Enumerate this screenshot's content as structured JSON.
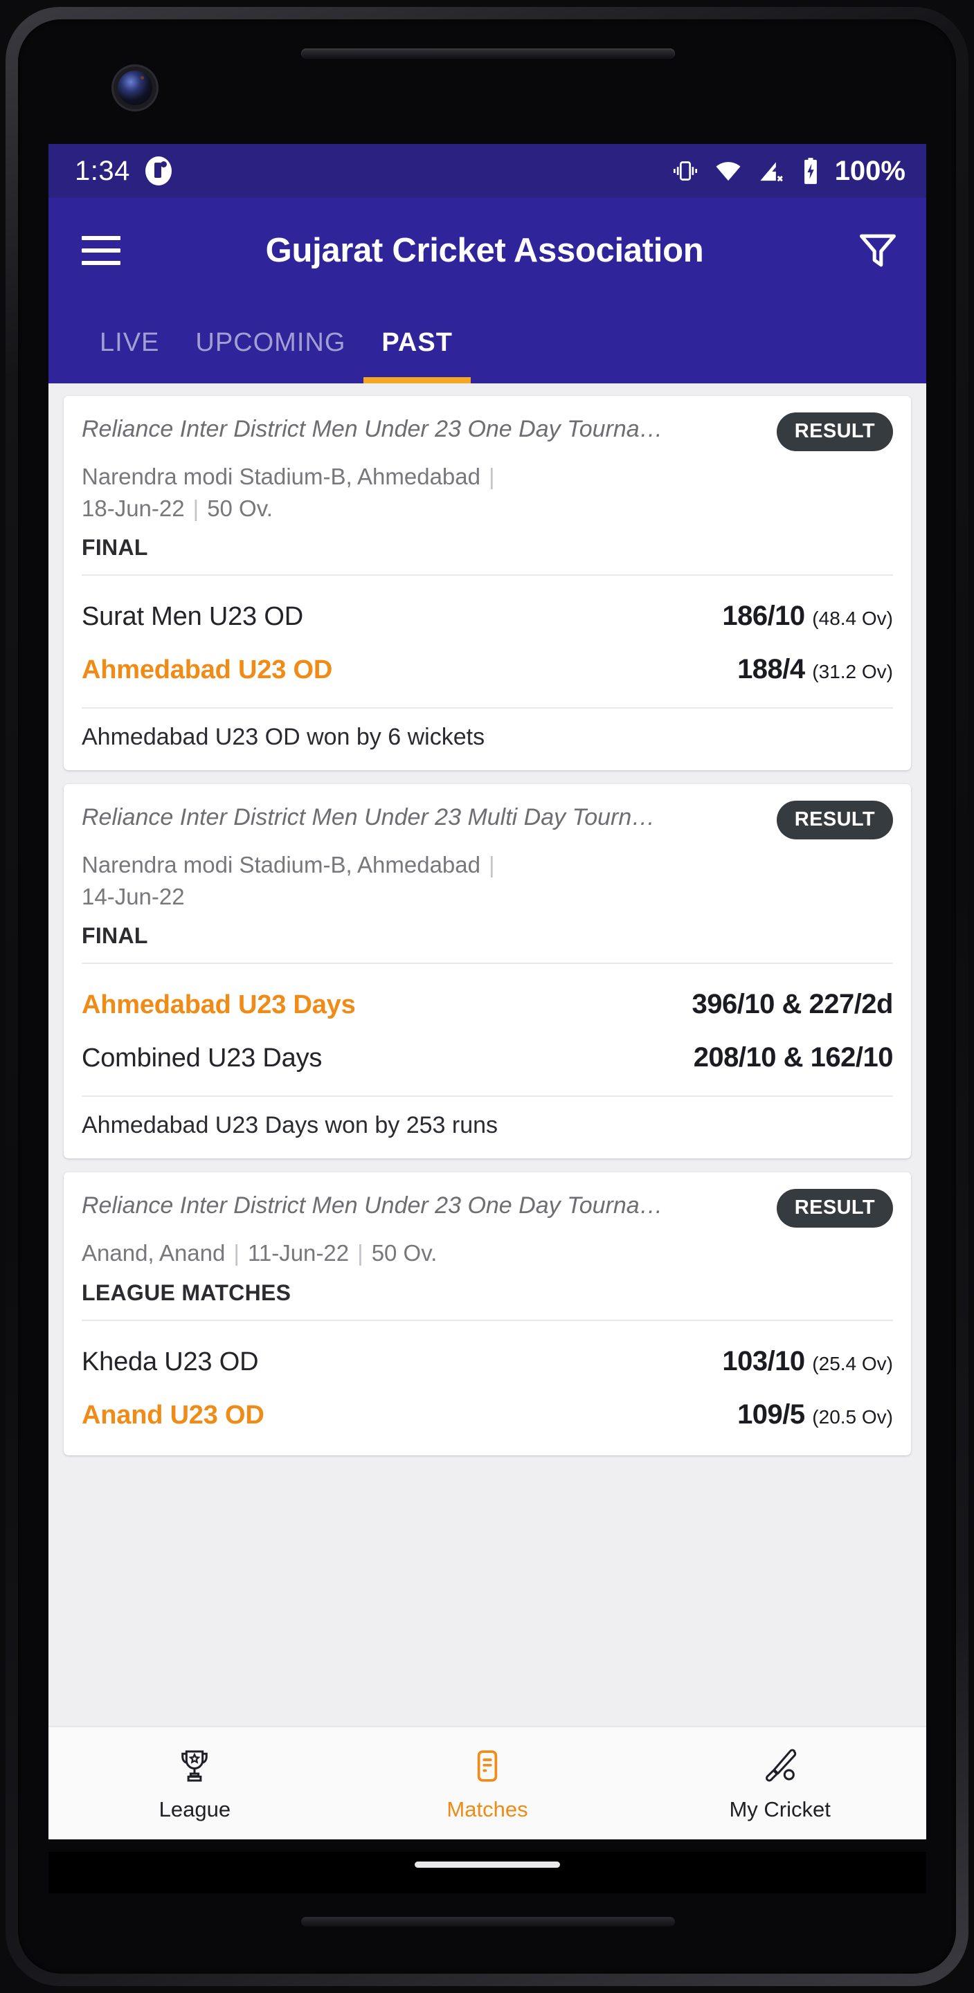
{
  "status_bar": {
    "time": "1:34",
    "notification_icon": "notification-dot-icon",
    "icons": [
      "vibrate-icon",
      "wifi-icon",
      "signal-no-service-icon",
      "battery-charging-icon"
    ],
    "battery": "100%"
  },
  "app_bar": {
    "menu_icon": "hamburger-menu-icon",
    "title": "Gujarat Cricket Association",
    "filter_icon": "filter-funnel-icon"
  },
  "tabs": [
    {
      "label": "LIVE",
      "active": false
    },
    {
      "label": "UPCOMING",
      "active": false
    },
    {
      "label": "PAST",
      "active": true
    }
  ],
  "accent_colors": {
    "app_bar": "#2f2499",
    "status_bar": "#2a2180",
    "tab_indicator": "#f5a623",
    "winner_text": "#ef8b16",
    "badge": "#363b40",
    "page_background": "#efeff1"
  },
  "matches": [
    {
      "tournament": "Reliance Inter District Men Under 23 One Day Tourna…",
      "badge": "RESULT",
      "venue": "Narendra modi Stadium-B, Ahmedabad",
      "date": "18-Jun-22",
      "overs": "50 Ov.",
      "stage": "FINAL",
      "teams": [
        {
          "name": "Surat Men U23 OD",
          "score": "186/10",
          "overs": "(48.4 Ov)",
          "winner": false
        },
        {
          "name": "Ahmedabad U23 OD",
          "score": "188/4",
          "overs": "(31.2 Ov)",
          "winner": true
        }
      ],
      "result": "Ahmedabad U23 OD won by 6 wickets"
    },
    {
      "tournament": "Reliance Inter District Men Under 23 Multi Day Tourn…",
      "badge": "RESULT",
      "venue": "Narendra modi Stadium-B, Ahmedabad",
      "date": "14-Jun-22",
      "overs": "",
      "stage": "FINAL",
      "teams": [
        {
          "name": "Ahmedabad U23 Days",
          "score": "396/10 & 227/2d",
          "overs": "",
          "winner": true
        },
        {
          "name": "Combined U23 Days",
          "score": "208/10 & 162/10",
          "overs": "",
          "winner": false
        }
      ],
      "result": "Ahmedabad U23 Days won by 253 runs"
    },
    {
      "tournament": "Reliance Inter District Men Under 23 One Day Tourna…",
      "badge": "RESULT",
      "venue": "Anand, Anand",
      "date": "11-Jun-22",
      "overs": "50 Ov.",
      "stage": "LEAGUE MATCHES",
      "teams": [
        {
          "name": "Kheda U23 OD",
          "score": "103/10",
          "overs": "(25.4 Ov)",
          "winner": false
        },
        {
          "name": "Anand U23 OD",
          "score": "109/5",
          "overs": "(20.5 Ov)",
          "winner": true
        }
      ],
      "result": ""
    }
  ],
  "bottom_nav": [
    {
      "label": "League",
      "icon": "trophy-icon",
      "active": false
    },
    {
      "label": "Matches",
      "icon": "list-document-icon",
      "active": true
    },
    {
      "label": "My Cricket",
      "icon": "cricket-bat-ball-icon",
      "active": false
    }
  ]
}
